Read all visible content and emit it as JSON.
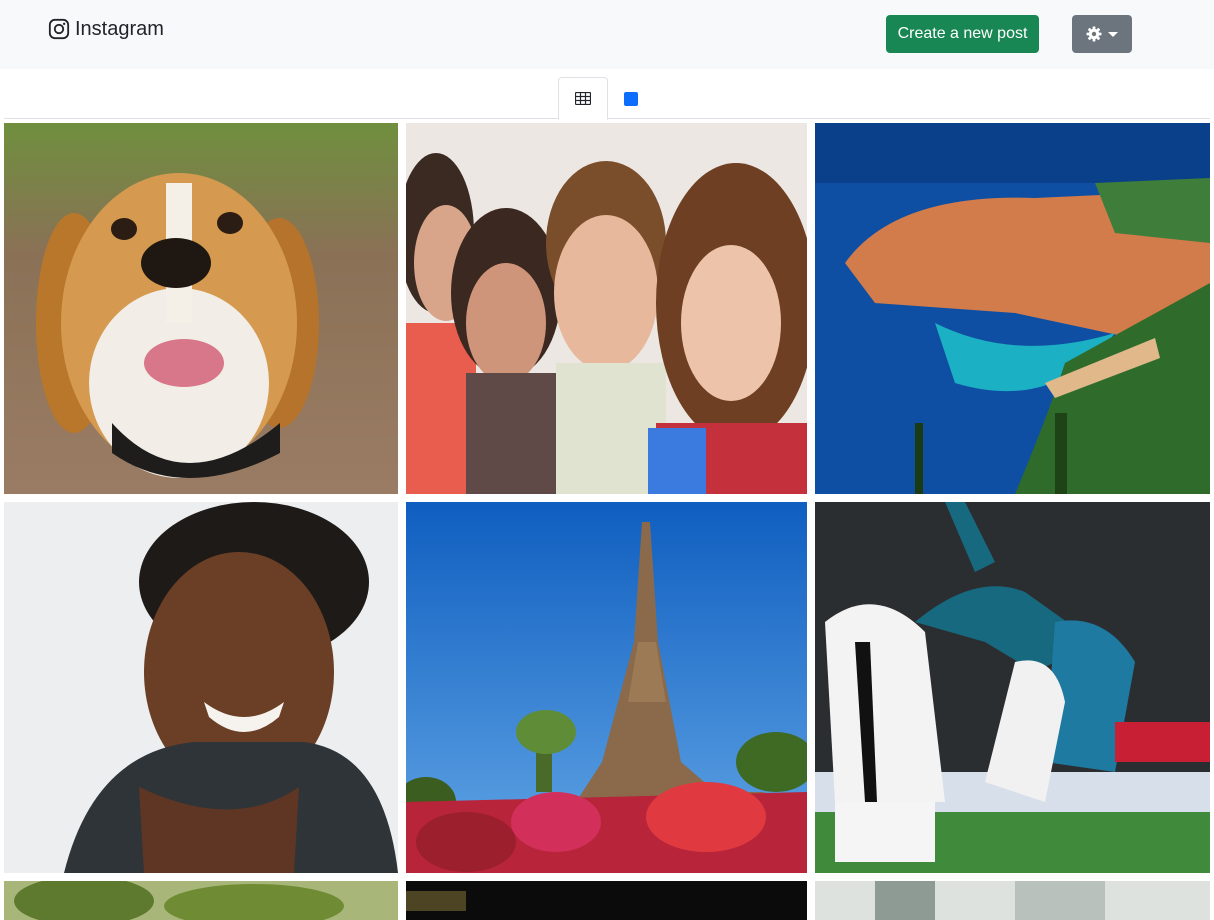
{
  "navbar": {
    "brand_label": "Instagram",
    "brand_icon": "instagram-icon",
    "create_button_label": "Create a new post",
    "settings_icon": "gear-icon",
    "create_button_color": "#198754",
    "settings_button_color": "#6c757d"
  },
  "view_tabs": [
    {
      "icon": "grid-icon",
      "active": true
    },
    {
      "icon": "square-icon",
      "active": false,
      "color": "#0d6efd"
    }
  ],
  "posts": [
    {
      "subject": "beagle-dog"
    },
    {
      "subject": "group-of-friends"
    },
    {
      "subject": "dubrovnik-old-town"
    },
    {
      "subject": "smiling-woman"
    },
    {
      "subject": "eiffel-tower-flowers"
    },
    {
      "subject": "football-bicycle-kick"
    },
    {
      "subject": "tree-foliage"
    },
    {
      "subject": "dark-sign"
    },
    {
      "subject": "window-interior"
    }
  ]
}
